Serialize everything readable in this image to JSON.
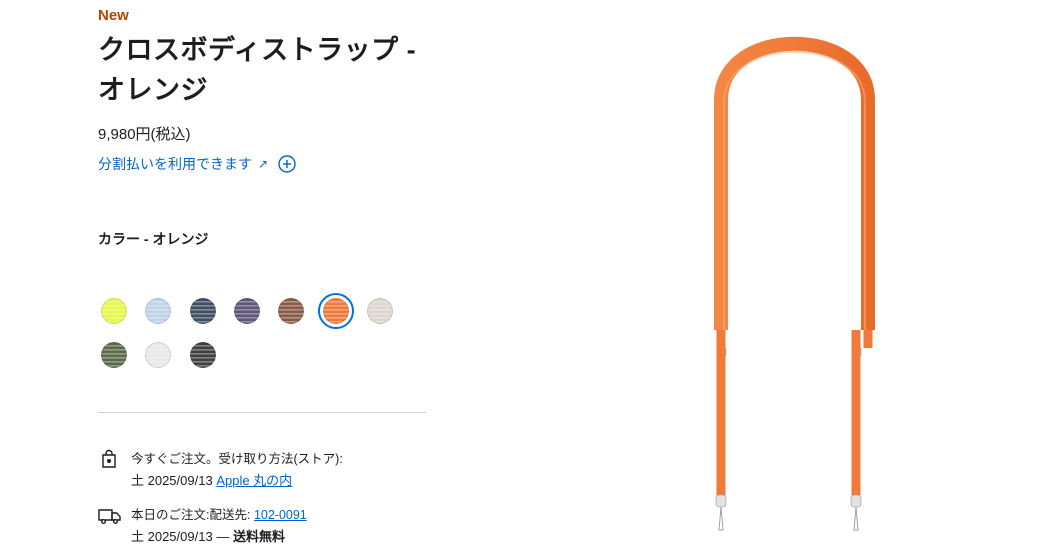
{
  "product": {
    "badge": "New",
    "title": "クロスボディストラップ - オレンジ",
    "price": "9,980円(税込)",
    "installment_link": "分割払いを利用できます",
    "installment_arrow": "↗"
  },
  "color": {
    "label": "カラー - オレンジ",
    "selected": "orange",
    "swatches": [
      {
        "name": "lime",
        "color": "#e6f74a"
      },
      {
        "name": "light-blue",
        "color": "#bfd3e6"
      },
      {
        "name": "navy",
        "color": "#3f4e63"
      },
      {
        "name": "purple",
        "color": "#5f5576"
      },
      {
        "name": "brown",
        "color": "#8a5a47"
      },
      {
        "name": "orange",
        "color": "#f07a3a"
      },
      {
        "name": "stone",
        "color": "#dcd6cc"
      },
      {
        "name": "green",
        "color": "#5b6b45"
      },
      {
        "name": "white",
        "color": "#e9e9e9"
      },
      {
        "name": "black",
        "color": "#404040"
      }
    ]
  },
  "pickup": {
    "line1": "今すぐご注文。受け取り方法(ストア):",
    "date": "土 2025/09/13",
    "store_link": "Apple 丸の内"
  },
  "delivery": {
    "line1_prefix": "本日のご注文:配送先:",
    "postal_link": "102-0091",
    "line2_date": "土 2025/09/13",
    "line2_sep": "—",
    "line2_shipping": "送料無料"
  },
  "colors": {
    "accent": "#0066cc",
    "badge": "#b64400",
    "strap": "#f07a3a"
  }
}
